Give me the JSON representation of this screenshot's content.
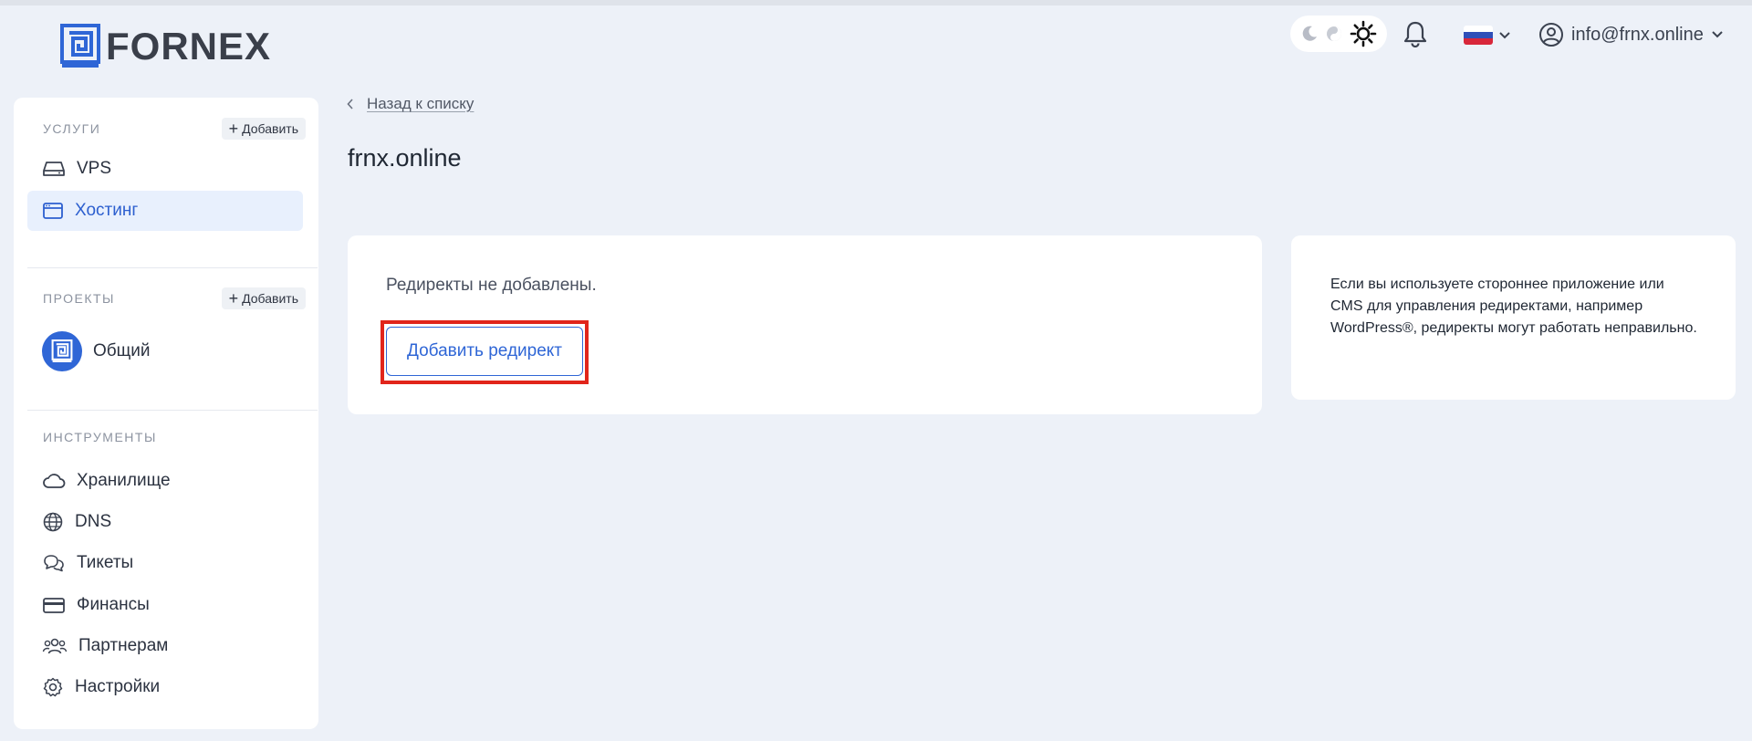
{
  "brand": {
    "name": "FORNEX"
  },
  "header": {
    "user_email": "info@frnx.online",
    "language": "ru",
    "theme_modes": [
      "moon-icon",
      "auto-icon",
      "sun-icon"
    ]
  },
  "sidebar": {
    "services": {
      "title": "Услуги",
      "add_label": "Добавить",
      "items": [
        {
          "label": "VPS",
          "icon": "server-icon"
        },
        {
          "label": "Хостинг",
          "icon": "browser-window-icon",
          "active": true
        }
      ]
    },
    "projects": {
      "title": "Проекты",
      "add_label": "Добавить",
      "items": [
        {
          "label": "Общий",
          "icon": "project-avatar"
        }
      ]
    },
    "tools": {
      "title": "Инструменты",
      "items": [
        {
          "label": "Хранилище",
          "icon": "cloud-icon"
        },
        {
          "label": "DNS",
          "icon": "globe-icon"
        },
        {
          "label": "Тикеты",
          "icon": "chat-icon"
        },
        {
          "label": "Финансы",
          "icon": "card-icon"
        },
        {
          "label": "Партнерам",
          "icon": "users-icon"
        },
        {
          "label": "Настройки",
          "icon": "gear-icon"
        }
      ]
    }
  },
  "main": {
    "back_label": "Назад к списку",
    "title": "frnx.online",
    "empty_message": "Редиректы не добавлены.",
    "add_button_label": "Добавить редирект",
    "info_text": "Если вы используете стороннее приложение или CMS для управления редиректами, например WordPress®, редиректы могут работать неправильно."
  },
  "colors": {
    "accent": "#2f66d6",
    "highlight": "#e1251b",
    "background": "#edf1f8"
  }
}
